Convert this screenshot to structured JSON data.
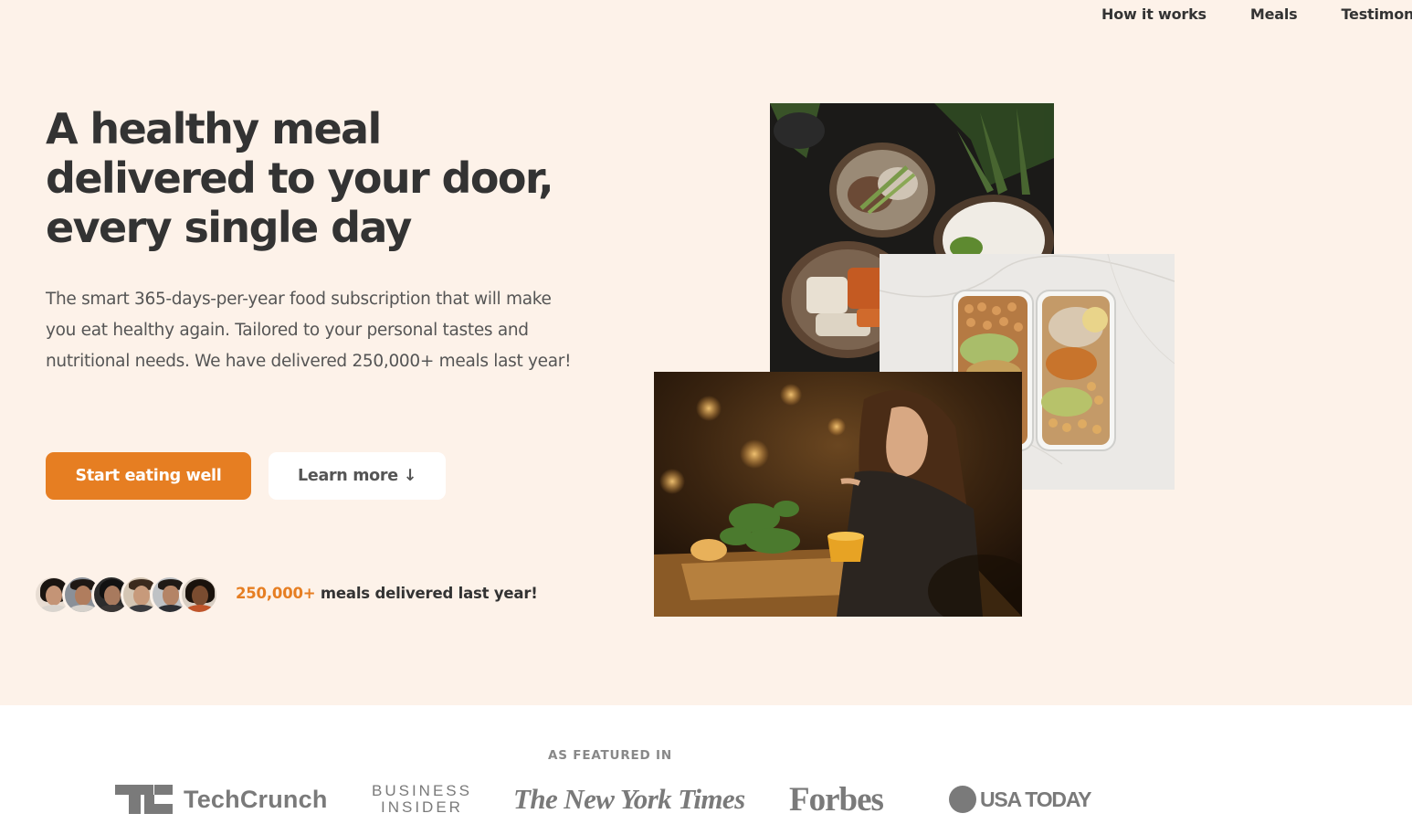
{
  "nav": {
    "items": [
      "How it works",
      "Meals",
      "Testimonials"
    ]
  },
  "hero": {
    "headline_lines": [
      "A healthy meal",
      "delivered to your door,",
      "every single day"
    ],
    "description": "The smart 365-days-per-year food subscription that will make you eat healthy again. Tailored to your personal tastes and nutritional needs. We have delivered 250,000+ meals last year!",
    "primary_cta": "Start eating well",
    "secondary_cta": "Learn more ↓",
    "delivered_count": "250,000+",
    "delivered_text": " meals delivered last year!"
  },
  "featured": {
    "label": "AS FEATURED IN",
    "logos": {
      "techcrunch": "TechCrunch",
      "business_insider_1": "BUSINESS",
      "business_insider_2": "INSIDER",
      "nyt": "The New York Times",
      "forbes": "Forbes",
      "usa_today": "USA TODAY"
    }
  },
  "colors": {
    "accent": "#e67e22",
    "hero_bg": "#fdf2e9",
    "text": "#333333",
    "logo_grey": "#7a7a7a"
  }
}
